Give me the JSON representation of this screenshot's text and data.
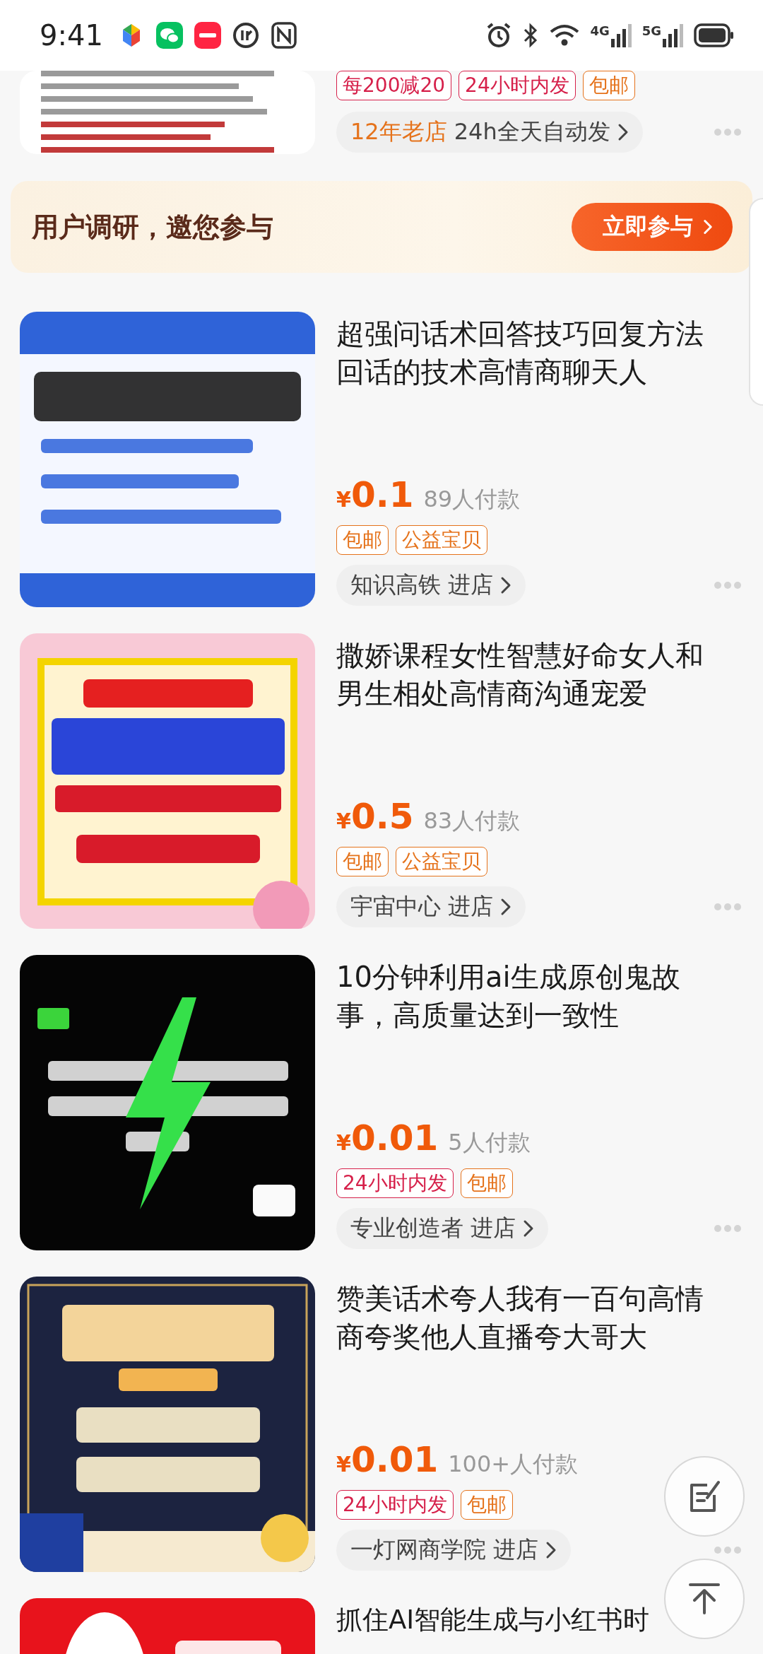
{
  "status_bar": {
    "time": "9:41",
    "net_labels": [
      "4G",
      "5G"
    ]
  },
  "partial_item": {
    "tags": [
      {
        "label": "每200减20",
        "color": "#d6204a"
      },
      {
        "label": "24小时内发",
        "color": "#d6204a"
      },
      {
        "label": "包邮",
        "color": "#e5731c"
      }
    ],
    "store": {
      "kind": "badge",
      "highlight": "12年老店",
      "name": "24h全天自动发"
    }
  },
  "survey": {
    "text": "用户调研，邀您参与",
    "button": "立即参与"
  },
  "items": [
    {
      "title": "超强问话术回答技巧回复方法回话的技术高情商聊天人",
      "currency": "¥",
      "price": "0.1",
      "sales": "89人付款",
      "tags": [
        {
          "label": "包邮",
          "color": "#e5731c"
        },
        {
          "label": "公益宝贝",
          "color": "#e5731c"
        }
      ],
      "store": {
        "kind": "shop",
        "name": "知识高铁",
        "action": "进店"
      }
    },
    {
      "title": "撒娇课程女性智慧好命女人和男生相处高情商沟通宠爱",
      "currency": "¥",
      "price": "0.5",
      "sales": "83人付款",
      "tags": [
        {
          "label": "包邮",
          "color": "#e5731c"
        },
        {
          "label": "公益宝贝",
          "color": "#e5731c"
        }
      ],
      "store": {
        "kind": "shop",
        "name": "宇宙中心",
        "action": "进店"
      }
    },
    {
      "title": "10分钟利用ai生成原创鬼故事，高质量达到一致性",
      "currency": "¥",
      "price": "0.01",
      "sales": "5人付款",
      "tags": [
        {
          "label": "24小时内发",
          "color": "#d6204a"
        },
        {
          "label": "包邮",
          "color": "#e5731c"
        }
      ],
      "store": {
        "kind": "shop",
        "name": "专业创造者",
        "action": "进店"
      }
    },
    {
      "title": "赞美话术夸人我有一百句高情商夸奖他人直播夸大哥大",
      "currency": "¥",
      "price": "0.01",
      "sales": "100+人付款",
      "tags": [
        {
          "label": "24小时内发",
          "color": "#d6204a"
        },
        {
          "label": "包邮",
          "color": "#e5731c"
        }
      ],
      "store": {
        "kind": "shop",
        "name": "一灯网商学院",
        "action": "进店"
      }
    },
    {
      "title": "抓住AI智能生成与小红书时",
      "kind": "cut"
    }
  ]
}
